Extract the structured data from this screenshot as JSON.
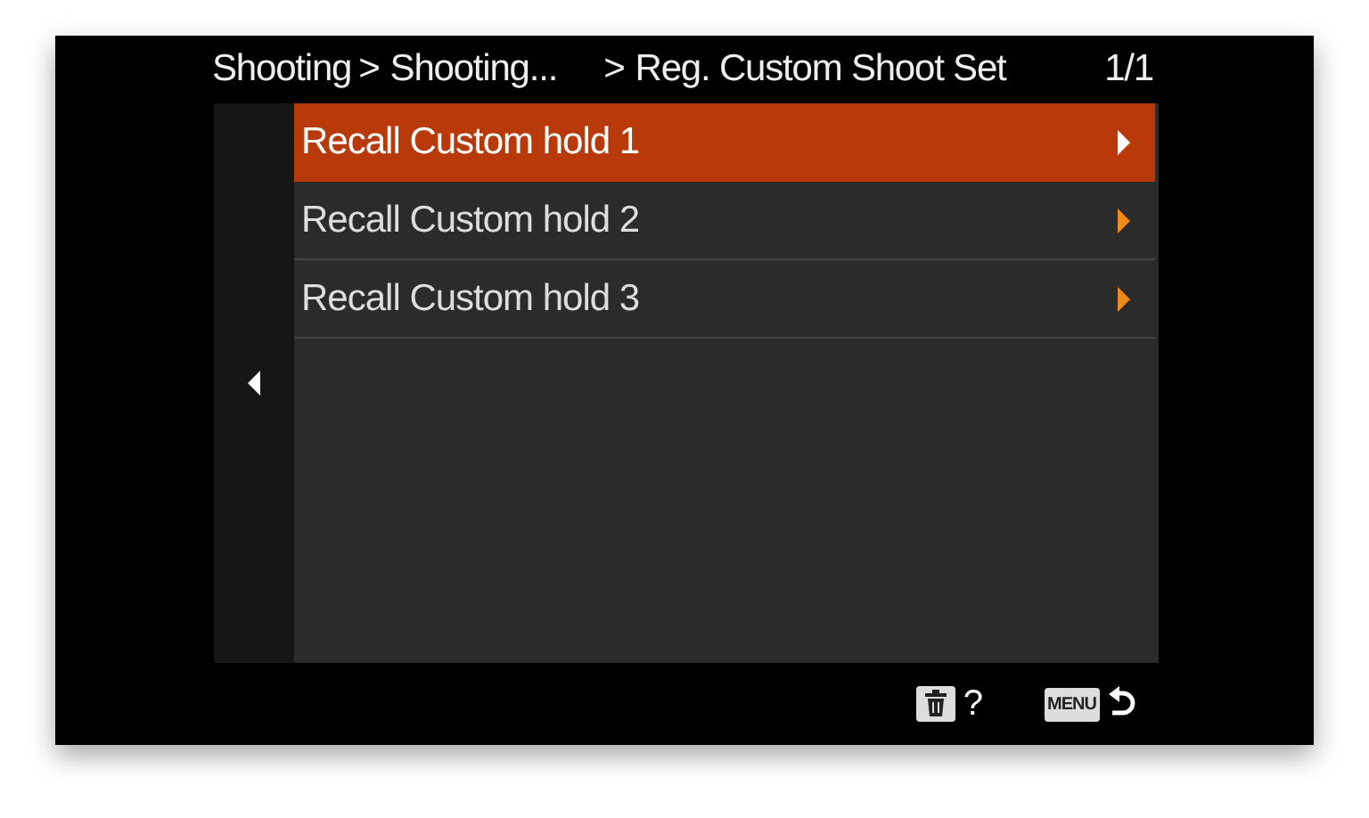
{
  "header": {
    "breadcrumb": [
      "Shooting",
      ">",
      "Shooting...",
      ">",
      "Reg. Custom Shoot Set"
    ],
    "page": "1/1"
  },
  "items": [
    {
      "label": "Recall Custom hold 1",
      "selected": true
    },
    {
      "label": "Recall Custom hold 2",
      "selected": false
    },
    {
      "label": "Recall Custom hold 3",
      "selected": false
    }
  ],
  "footer": {
    "help": "?",
    "menu_key": "MENU"
  }
}
